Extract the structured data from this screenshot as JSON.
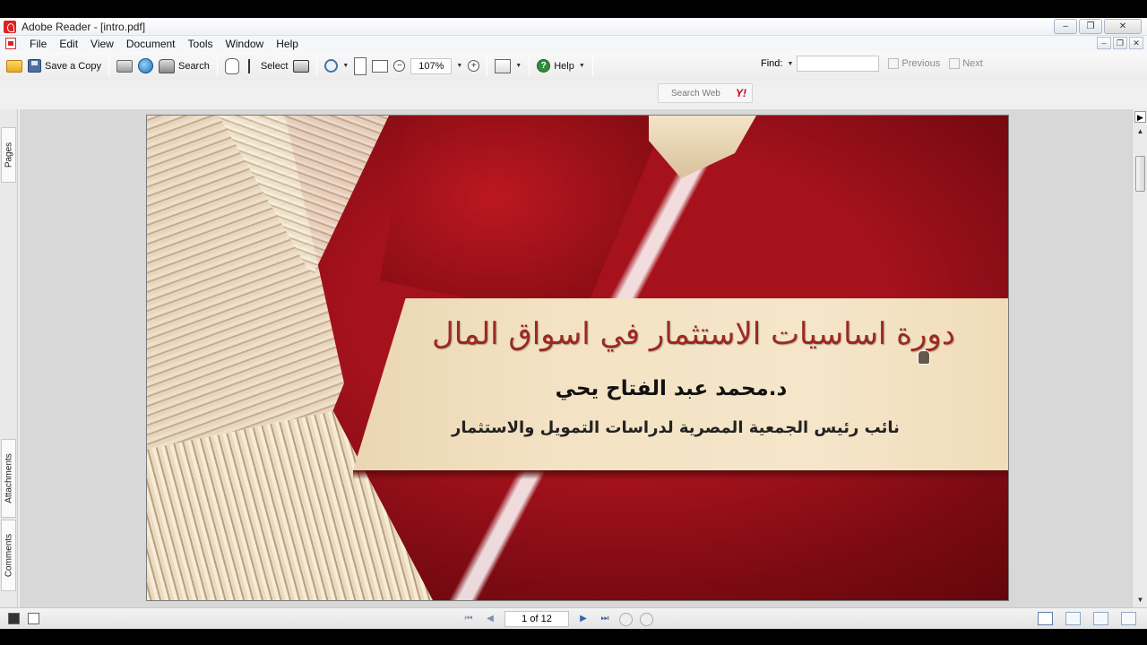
{
  "window": {
    "title": "Adobe Reader - [intro.pdf]"
  },
  "menu": [
    "File",
    "Edit",
    "View",
    "Document",
    "Tools",
    "Window",
    "Help"
  ],
  "toolbar": {
    "save_copy": "Save a Copy",
    "search": "Search",
    "select": "Select",
    "zoom": "107%",
    "help": "Help",
    "find_label": "Find:",
    "find_value": "",
    "previous": "Previous",
    "next": "Next",
    "search_web": "Search Web",
    "search_web_logo": "Y!"
  },
  "side_tabs": {
    "pages": "Pages",
    "attachments": "Attachments",
    "comments": "Comments"
  },
  "slide": {
    "title": "دورة اساسيات الاستثمار في اسواق المال",
    "author": "د.محمد عبد الفتاح يحي",
    "role": "نائب رئيس الجمعية المصرية لدراسات التمويل والاستثمار"
  },
  "status": {
    "page_indicator": "1 of 12"
  },
  "colors": {
    "slide_bg": "#a5121c",
    "title_text": "#9b2a22",
    "banner": "#f3e2c3"
  }
}
